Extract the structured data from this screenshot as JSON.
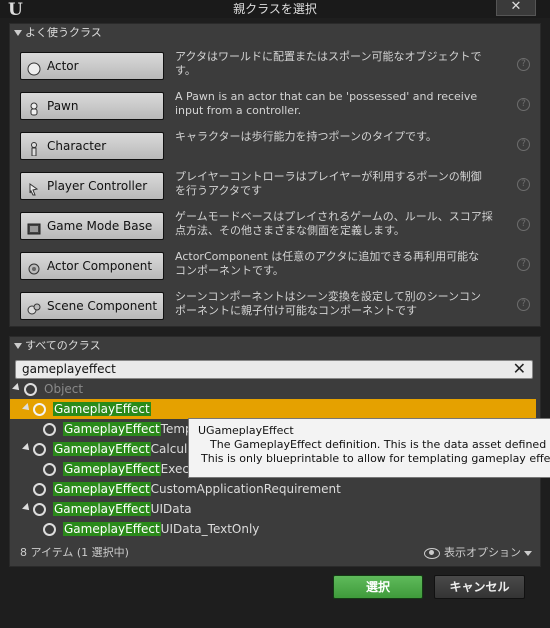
{
  "window": {
    "title": "親クラスを選択",
    "close_glyph": "✕"
  },
  "common": {
    "header": "よく使うクラス",
    "items": [
      {
        "label": "Actor",
        "icon": "sphere-icon",
        "desc1": "アクタはワールドに配置またはスポーン可能なオブジェクトで",
        "desc2": "す。"
      },
      {
        "label": "Pawn",
        "icon": "pawn-icon",
        "desc1": "A Pawn is an actor that can be 'possessed' and receive",
        "desc2": "input from a controller."
      },
      {
        "label": "Character",
        "icon": "character-icon",
        "desc1": "キャラクターは歩行能力を持つポーンのタイプです。",
        "desc2": ""
      },
      {
        "label": "Player Controller",
        "icon": "player-controller-icon",
        "desc1": "プレイヤーコントローラはプレイヤーが利用するポーンの制御",
        "desc2": "を行うアクタです"
      },
      {
        "label": "Game Mode Base",
        "icon": "game-mode-icon",
        "desc1": "ゲームモードベースはプレイされるゲームの、ルール、スコア採",
        "desc2": "点方法、その他さまざまな側面を定義します。"
      },
      {
        "label": "Actor Component",
        "icon": "actor-component-icon",
        "desc1": "ActorComponent は任意のアクタに追加できる再利用可能な",
        "desc2": "コンポーネントです。"
      },
      {
        "label": "Scene Component",
        "icon": "scene-component-icon",
        "desc1": "シーンコンポーネントはシーン変換を設定して別のシーンコン",
        "desc2": "ポーネントに親子付け可能なコンポーネントです"
      }
    ],
    "help_glyph": "?"
  },
  "all": {
    "header": "すべてのクラス",
    "search_value": "gameplayeffect",
    "clear_glyph": "✕",
    "tree": [
      {
        "hl": "",
        "rest": "Object"
      },
      {
        "hl": "GameplayEffect",
        "rest": ""
      },
      {
        "hl": "GameplayEffect",
        "rest": "Templa"
      },
      {
        "hl": "GameplayEffect",
        "rest": "Calculati"
      },
      {
        "hl": "GameplayEffect",
        "rest": "Executi"
      },
      {
        "hl": "GameplayEffect",
        "rest": "CustomApplicationRequirement"
      },
      {
        "hl": "GameplayEffect",
        "rest": "UIData"
      },
      {
        "hl": "GameplayEffect",
        "rest": "UIData_TextOnly"
      }
    ],
    "count_text": "8 アイテム (1 選択中)",
    "view_options": "表示オプション"
  },
  "tooltip": {
    "line1": "UGameplayEffect",
    "line2": "The GameplayEffect definition. This is the data asset defined in",
    "line3": "This is only blueprintable to allow for templating gameplay effects."
  },
  "buttons": {
    "select": "選択",
    "cancel": "キャンセル"
  }
}
